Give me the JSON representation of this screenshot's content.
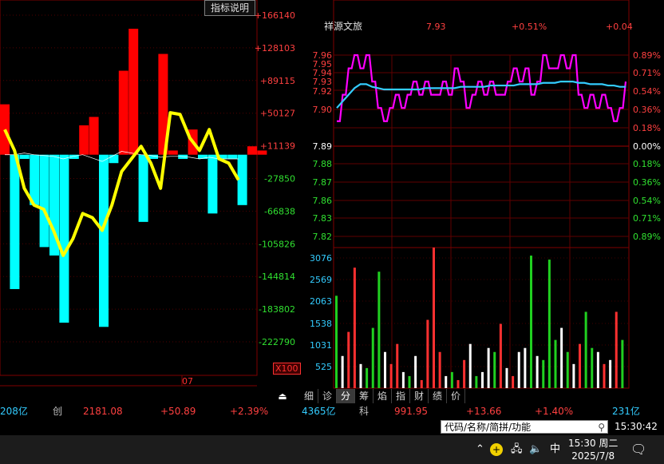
{
  "left_panel": {
    "indicator_button": "指标说明",
    "x_scale_badge": "X100",
    "date_label": "07",
    "y_labels": [
      "+166140",
      "+128103",
      "+89115",
      "+50127",
      "+11139",
      "-27850",
      "-66838",
      "-105826",
      "-144814",
      "-183802",
      "-222790"
    ],
    "bars": [
      {
        "v": 60000
      },
      {
        "v": -160000
      },
      {
        "v": -5000
      },
      {
        "v": -60000
      },
      {
        "v": -110000
      },
      {
        "v": -120000
      },
      {
        "v": -200000
      },
      {
        "v": -5000
      },
      {
        "v": 35000
      },
      {
        "v": 45000
      },
      {
        "v": -205000
      },
      {
        "v": -10000
      },
      {
        "v": 100000
      },
      {
        "v": 150000
      },
      {
        "v": -80000
      },
      {
        "v": -5000
      },
      {
        "v": 120000
      },
      {
        "v": 5000
      },
      {
        "v": -5000
      },
      {
        "v": 30000
      },
      {
        "v": -5000
      },
      {
        "v": -70000
      },
      {
        "v": -5000
      },
      {
        "v": -5000
      },
      {
        "v": -60000
      },
      {
        "v": 10000
      },
      {
        "v": 5000
      }
    ],
    "yellow_line": [
      30000,
      5000,
      -40000,
      -60000,
      -65000,
      -90000,
      -120000,
      -100000,
      -70000,
      -75000,
      -90000,
      -60000,
      -20000,
      -5000,
      10000,
      -10000,
      -40000,
      50000,
      48000,
      20000,
      5000,
      30000,
      -5000,
      -10000,
      -30000
    ],
    "thin_line": [
      0,
      0,
      2000,
      0,
      -1000,
      -2000,
      -5000,
      -2000,
      0,
      -4000,
      -8000,
      -2000,
      4000,
      2000,
      0,
      -1000,
      -3000,
      -2000,
      -2000,
      -3000,
      -5000,
      -3000,
      -5000,
      -5000,
      -5000
    ],
    "colors": {
      "up": "#ff0000",
      "down": "#00ffff",
      "yellow": "#ffff00"
    }
  },
  "right_panel": {
    "header": {
      "name": "祥源文旅",
      "price": "7.93",
      "change_pct": "+0.51%",
      "change": "+0.04"
    },
    "price_labels_left": [
      "7.96",
      "7.95",
      "7.94",
      "7.93",
      "7.92",
      "7.90",
      "7.89",
      "7.88",
      "7.87",
      "7.86",
      "7.85",
      "7.84",
      "7.83",
      "7.82"
    ],
    "price_labels_right": [
      "0.89%",
      "0.71%",
      "0.54%",
      "0.36%",
      "0.18%",
      "0.00%",
      "0.18%",
      "0.36%",
      "0.54%",
      "0.71%",
      "0.89%"
    ],
    "volume_labels": [
      "3076",
      "2569",
      "2063",
      "1538",
      "1031",
      "525"
    ],
    "price_series": [
      7.91,
      7.93,
      7.95,
      7.96,
      7.95,
      7.96,
      7.94,
      7.92,
      7.91,
      7.92,
      7.93,
      7.92,
      7.93,
      7.94,
      7.93,
      7.94,
      7.93,
      7.93,
      7.94,
      7.93,
      7.95,
      7.94,
      7.92,
      7.93,
      7.94,
      7.93,
      7.94,
      7.93,
      7.93,
      7.94,
      7.95,
      7.94,
      7.95,
      7.93,
      7.94,
      7.96,
      7.95,
      7.95,
      7.96,
      7.95,
      7.96,
      7.93,
      7.92,
      7.93,
      7.92,
      7.93,
      7.92,
      7.91,
      7.92,
      7.94
    ],
    "avg_series": [
      7.92,
      7.925,
      7.93,
      7.935,
      7.938,
      7.938,
      7.936,
      7.935,
      7.934,
      7.934,
      7.934,
      7.934,
      7.934,
      7.934,
      7.934,
      7.935,
      7.935,
      7.935,
      7.935,
      7.935,
      7.935,
      7.936,
      7.936,
      7.936,
      7.936,
      7.936,
      7.937,
      7.937,
      7.937,
      7.937,
      7.937,
      7.938,
      7.938,
      7.938,
      7.938,
      7.939,
      7.939,
      7.939,
      7.94,
      7.94,
      7.94,
      7.939,
      7.939,
      7.938,
      7.938,
      7.938,
      7.937,
      7.937,
      7.936,
      7.936
    ],
    "volume_series": [
      {
        "v": 2300,
        "c": "g"
      },
      {
        "v": 800,
        "c": "w"
      },
      {
        "v": 1400,
        "c": "r"
      },
      {
        "v": 3000,
        "c": "r"
      },
      {
        "v": 600,
        "c": "w"
      },
      {
        "v": 500,
        "c": "g"
      },
      {
        "v": 1500,
        "c": "g"
      },
      {
        "v": 2900,
        "c": "g"
      },
      {
        "v": 900,
        "c": "w"
      },
      {
        "v": 600,
        "c": "r"
      },
      {
        "v": 1100,
        "c": "r"
      },
      {
        "v": 400,
        "c": "w"
      },
      {
        "v": 300,
        "c": "g"
      },
      {
        "v": 800,
        "c": "w"
      },
      {
        "v": 200,
        "c": "r"
      },
      {
        "v": 1700,
        "c": "r"
      },
      {
        "v": 3500,
        "c": "r"
      },
      {
        "v": 900,
        "c": "r"
      },
      {
        "v": 300,
        "c": "w"
      },
      {
        "v": 400,
        "c": "g"
      },
      {
        "v": 200,
        "c": "r"
      },
      {
        "v": 700,
        "c": "r"
      },
      {
        "v": 1100,
        "c": "w"
      },
      {
        "v": 300,
        "c": "g"
      },
      {
        "v": 400,
        "c": "w"
      },
      {
        "v": 1000,
        "c": "w"
      },
      {
        "v": 900,
        "c": "g"
      },
      {
        "v": 1600,
        "c": "r"
      },
      {
        "v": 500,
        "c": "w"
      },
      {
        "v": 300,
        "c": "r"
      },
      {
        "v": 900,
        "c": "w"
      },
      {
        "v": 1000,
        "c": "w"
      },
      {
        "v": 3300,
        "c": "g"
      },
      {
        "v": 800,
        "c": "w"
      },
      {
        "v": 700,
        "c": "g"
      },
      {
        "v": 3200,
        "c": "g"
      },
      {
        "v": 1200,
        "c": "g"
      },
      {
        "v": 1500,
        "c": "w"
      },
      {
        "v": 900,
        "c": "g"
      },
      {
        "v": 600,
        "c": "w"
      },
      {
        "v": 1100,
        "c": "r"
      },
      {
        "v": 1900,
        "c": "g"
      },
      {
        "v": 1000,
        "c": "g"
      },
      {
        "v": 900,
        "c": "w"
      },
      {
        "v": 600,
        "c": "r"
      },
      {
        "v": 700,
        "c": "w"
      },
      {
        "v": 1900,
        "c": "r"
      },
      {
        "v": 1200,
        "c": "g"
      }
    ],
    "colors": {
      "price": "#ff00ff",
      "avg": "#33ccff",
      "vol_r": "#ff3030",
      "vol_g": "#20d020",
      "vol_w": "#ffffff"
    }
  },
  "tabs": [
    "细",
    "诊",
    "分",
    "筹",
    "焰",
    "指",
    "财",
    "绩",
    "价"
  ],
  "active_tab": "分",
  "ticker": {
    "i1": "208亿",
    "i2_name": "创",
    "i2_value": "2181.08",
    "i2_change": "+50.89",
    "i2_pct": "+2.39%",
    "i3": "4365亿",
    "i4_name": "科",
    "i4_value": "991.95",
    "i4_change": "+13.66",
    "i4_pct": "+1.40%",
    "i5": "231亿"
  },
  "search": {
    "placeholder": "代码/名称/简拼/功能"
  },
  "status_time": "15:30:42",
  "taskbar": {
    "ime": "中",
    "time": "15:30 周二",
    "date": "2025/7/8"
  }
}
